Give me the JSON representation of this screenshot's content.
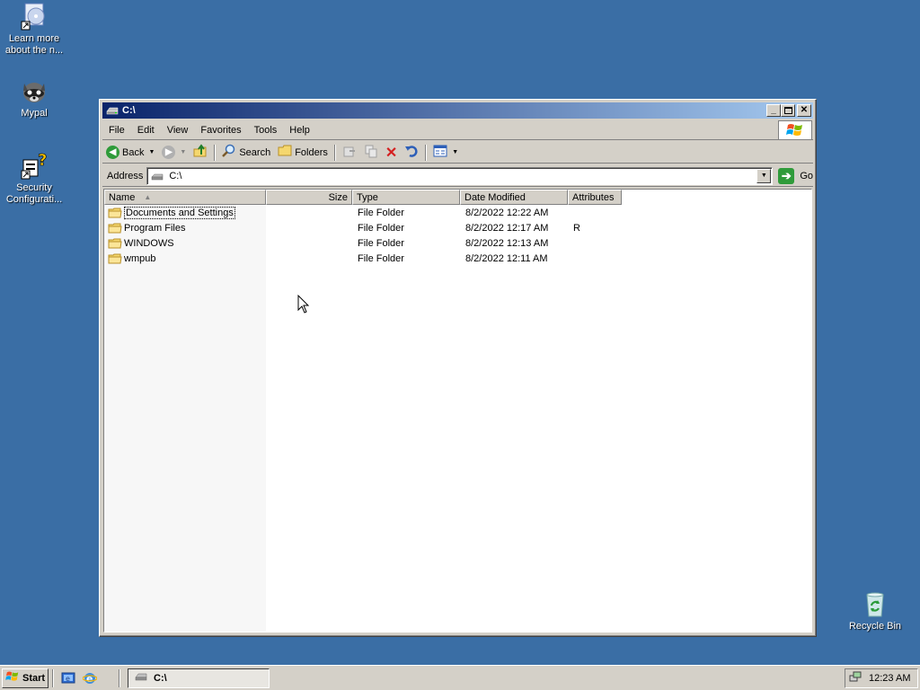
{
  "desktop": {
    "icons": [
      {
        "label": "Learn more about the n...",
        "icon": "cd-info-icon"
      },
      {
        "label": "Mypal",
        "icon": "raccoon-icon"
      },
      {
        "label": "Security Configurati...",
        "icon": "security-config-icon"
      },
      {
        "label": "Recycle Bin",
        "icon": "recycle-bin-icon"
      }
    ]
  },
  "window": {
    "title": "C:\\",
    "menu": {
      "file": "File",
      "edit": "Edit",
      "view": "View",
      "favorites": "Favorites",
      "tools": "Tools",
      "help": "Help"
    },
    "toolbar": {
      "back": "Back",
      "search": "Search",
      "folders": "Folders"
    },
    "address": {
      "label": "Address",
      "value": "C:\\",
      "go": "Go"
    },
    "columns": [
      "Name",
      "Size",
      "Type",
      "Date Modified",
      "Attributes"
    ],
    "rows": [
      {
        "name": "Documents and Settings",
        "size": "",
        "type": "File Folder",
        "date": "8/2/2022 12:22 AM",
        "attr": ""
      },
      {
        "name": "Program Files",
        "size": "",
        "type": "File Folder",
        "date": "8/2/2022 12:17 AM",
        "attr": "R"
      },
      {
        "name": "WINDOWS",
        "size": "",
        "type": "File Folder",
        "date": "8/2/2022 12:13 AM",
        "attr": ""
      },
      {
        "name": "wmpub",
        "size": "",
        "type": "File Folder",
        "date": "8/2/2022 12:11 AM",
        "attr": ""
      }
    ]
  },
  "taskbar": {
    "start": "Start",
    "task": "C:\\",
    "clock": "12:23 AM"
  },
  "colors": {
    "desktop": "#3a6ea5",
    "titlebar_start": "#0a246a",
    "titlebar_end": "#a6caf0",
    "chrome": "#d4d0c8"
  }
}
